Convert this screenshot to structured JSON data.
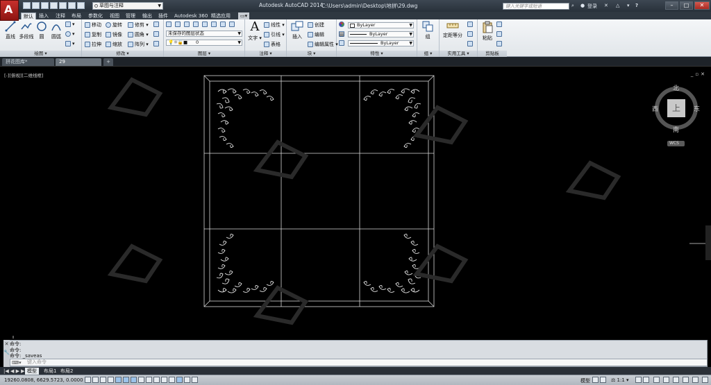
{
  "title_bar": {
    "workspace": "草图与注释",
    "app_title": "Autodesk AutoCAD 2014",
    "file_path": "C:\\Users\\admin\\Desktop\\地拼\\29.dwg",
    "search_placeholder": "键入关键字或短语",
    "signin": "登录"
  },
  "ribbon_tabs": [
    "默认",
    "插入",
    "注释",
    "布局",
    "参数化",
    "视图",
    "管理",
    "输出",
    "插件",
    "Autodesk 360",
    "精选应用"
  ],
  "panels": {
    "draw": {
      "title": "绘图",
      "line": "直线",
      "polyline": "多段线",
      "circle": "圆",
      "arc": "圆弧"
    },
    "modify": {
      "title": "修改",
      "move": "移动",
      "rotate": "旋转",
      "trim": "修剪",
      "copy": "复制",
      "mirror": "镜像",
      "fillet": "圆角",
      "stretch": "拉伸",
      "scale": "缩放",
      "array": "阵列"
    },
    "layers": {
      "title": "图层",
      "layer_state": "未保存的图层状态",
      "layer_value": "0"
    },
    "annotation": {
      "title": "注释",
      "text": "文字",
      "linear": "线性",
      "leader": "引线",
      "table": "表格"
    },
    "block": {
      "title": "块",
      "insert": "插入",
      "create": "创建",
      "edit": "编辑",
      "edit_attr": "编辑属性"
    },
    "properties": {
      "title": "特性",
      "color": "ByLayer",
      "linetype": "ByLayer",
      "lineweight": "ByLayer"
    },
    "groups": {
      "title": "组",
      "group": "组"
    },
    "utilities": {
      "title": "实用工具",
      "measure": "测量",
      "divide": "定距等分"
    },
    "clipboard": {
      "title": "剪贴板",
      "paste": "粘贴"
    }
  },
  "doc_tabs": [
    "拼花图库*",
    "29"
  ],
  "viewport_label": "[-][俯视][二维线框]",
  "viewcube": {
    "north": "北",
    "south": "南",
    "east": "东",
    "west": "西",
    "top": "上",
    "wcs": "WCS"
  },
  "command_history": [
    "命令:",
    "命令:",
    "命令: _saveas"
  ],
  "command_placeholder": "键入命令",
  "layout_tabs": [
    "模型",
    "布局1",
    "布局2"
  ],
  "status": {
    "coords": "19260.0808, 6629.5723, 0.0000",
    "model": "模型",
    "scale": "1:1"
  }
}
